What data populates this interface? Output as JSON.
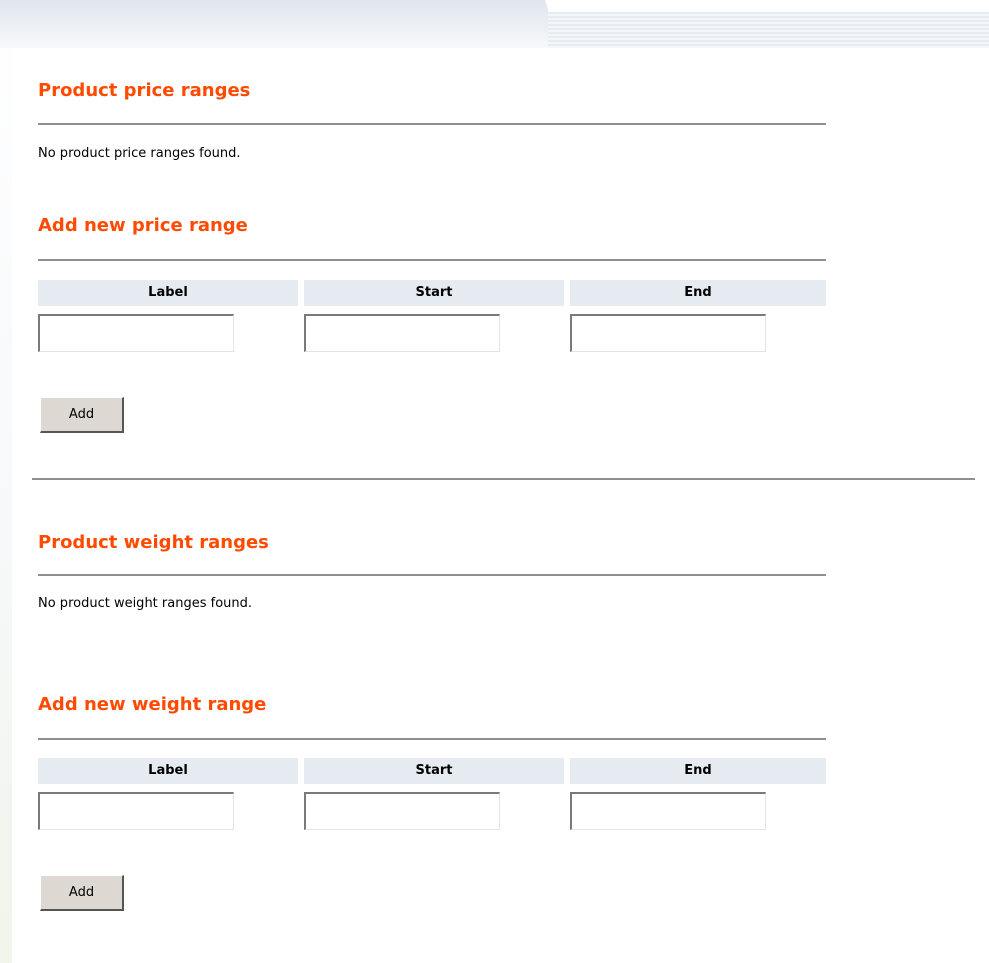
{
  "price_section": {
    "title": "Product price ranges",
    "empty_message": "No product price ranges found."
  },
  "add_price": {
    "title": "Add new price range",
    "columns": [
      "Label",
      "Start",
      "End"
    ],
    "fields": {
      "label": "",
      "start": "",
      "end": ""
    },
    "button_label": "Add"
  },
  "weight_section": {
    "title": "Product weight ranges",
    "empty_message": "No product weight ranges found."
  },
  "add_weight": {
    "title": "Add new weight range",
    "columns": [
      "Label",
      "Start",
      "End"
    ],
    "fields": {
      "label": "",
      "start": "",
      "end": ""
    },
    "button_label": "Add"
  },
  "colors": {
    "heading": "#ff4a00",
    "column_header_bg": "#e6ebf1",
    "button_bg": "#ddd9d2"
  }
}
